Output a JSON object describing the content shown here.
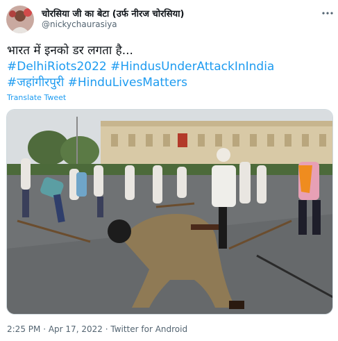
{
  "author": {
    "display_name": "चोरसिया जी का बेटा (उर्फ नीरज चोरसिया)",
    "handle": "@nickychaurasiya"
  },
  "tweet": {
    "text_line1": "भारत में इनको डर लगता है...",
    "hashtags_line2": [
      "#DelhiRiots2022",
      "#HindusUnderAttackInIndia"
    ],
    "hashtags_line3": [
      "#जहांगीरपुरी",
      "#HinduLivesMatters"
    ],
    "translate_label": "Translate Tweet"
  },
  "meta": {
    "time": "2:25 PM",
    "separator": "·",
    "date": "Apr 17, 2022",
    "source": "Twitter for Android"
  },
  "icons": {
    "more": "more-dots-icon"
  },
  "colors": {
    "hashtag": "#1d9bf0",
    "secondary_text": "#536471",
    "primary_text": "#0f1419"
  }
}
